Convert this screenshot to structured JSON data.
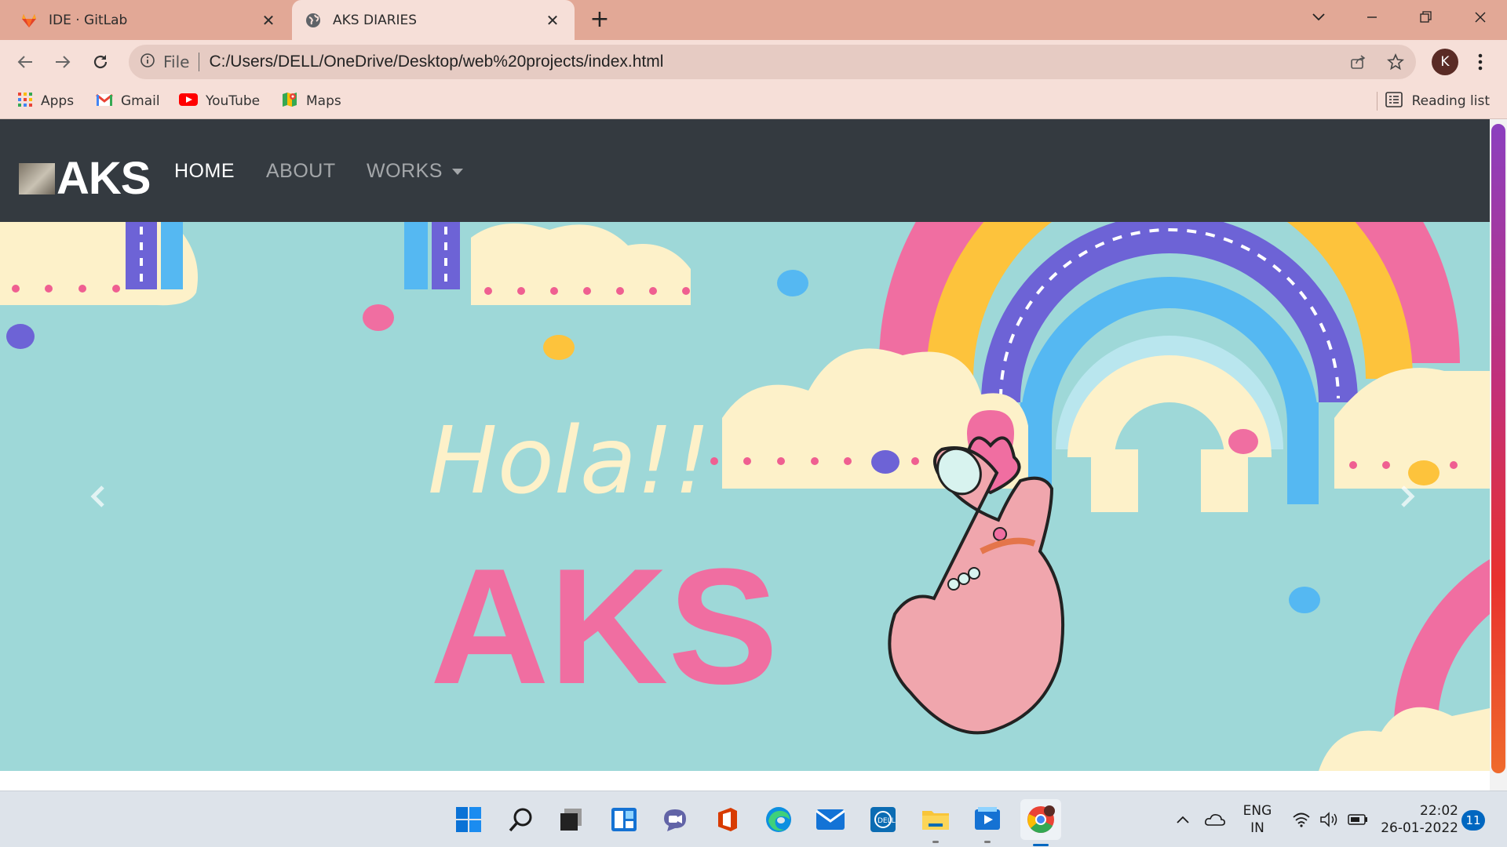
{
  "tabs": [
    {
      "title": "IDE · GitLab",
      "favicon": "gitlab-icon"
    },
    {
      "title": "AKS DIARIES",
      "favicon": "globe-icon"
    }
  ],
  "address_bar": {
    "scheme": "File",
    "url": "C:/Users/DELL/OneDrive/Desktop/web%20projects/index.html"
  },
  "profile_initial": "K",
  "bookmarks": [
    {
      "label": "Apps",
      "icon": "apps-grid-icon"
    },
    {
      "label": "Gmail",
      "icon": "gmail-icon"
    },
    {
      "label": "YouTube",
      "icon": "youtube-icon"
    },
    {
      "label": "Maps",
      "icon": "maps-icon"
    }
  ],
  "reading_list": "Reading list",
  "site": {
    "brand": "AKS",
    "nav": [
      {
        "label": "HOME",
        "active": true
      },
      {
        "label": "ABOUT",
        "active": false
      },
      {
        "label": "WORKS",
        "active": false,
        "dropdown": true
      }
    ],
    "hero": {
      "greeting": "Hola!!",
      "title": "AKS"
    }
  },
  "taskbar": {
    "language": "ENG",
    "region": "IN",
    "time": "22:02",
    "date": "26-01-2022",
    "notifications": "11"
  }
}
